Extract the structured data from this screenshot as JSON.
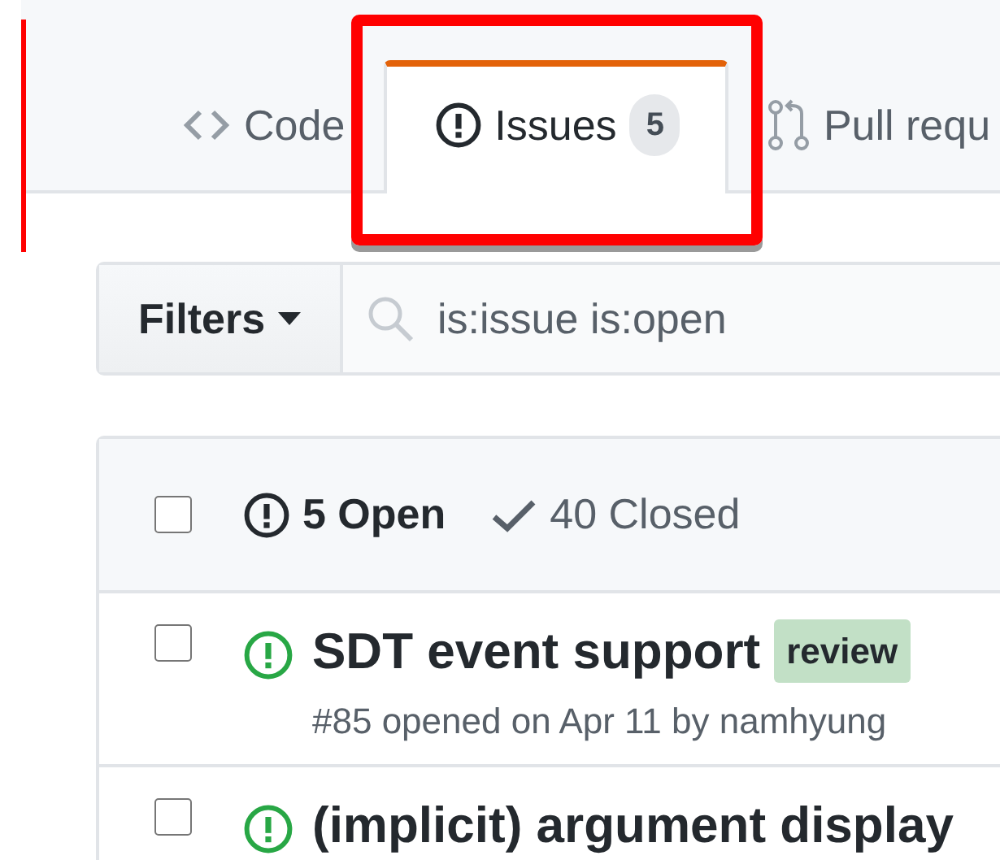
{
  "edge_annotation": true,
  "tabs": [
    {
      "kind": "code",
      "label": "Code",
      "selected": false,
      "annotated": false
    },
    {
      "kind": "issues",
      "label": "Issues",
      "counter": "5",
      "selected": true,
      "annotated": true
    },
    {
      "kind": "pulls",
      "label": "Pull requ",
      "selected": false,
      "annotated": false
    }
  ],
  "filters": {
    "button": "Filters",
    "search_value": "is:issue is:open"
  },
  "issues_header": {
    "checked": false,
    "open": "5 Open",
    "closed": "40 Closed"
  },
  "issues": [
    {
      "checked": false,
      "title": "SDT event support",
      "labels": [
        {
          "name": "review",
          "color": "#c2e0c6"
        }
      ],
      "meta": "#85 opened on Apr 11 by namhyung"
    },
    {
      "checked": false,
      "title": "(implicit) argument display"
    }
  ]
}
